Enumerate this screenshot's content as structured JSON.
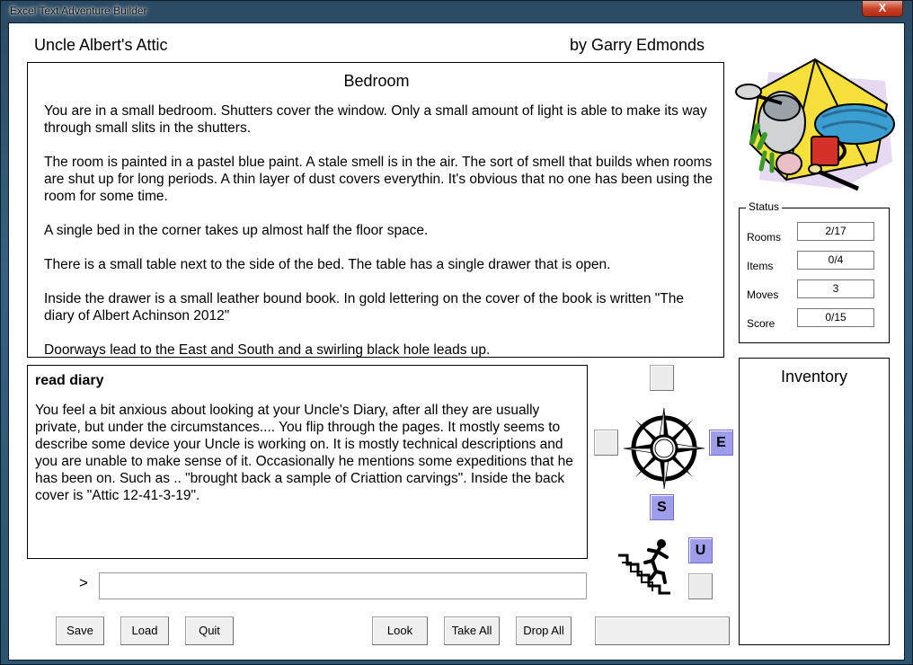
{
  "window": {
    "title": "Excel Text Adventure Builder",
    "close_label": "X"
  },
  "game": {
    "title": "Uncle Albert's Attic",
    "author": "by Garry Edmonds"
  },
  "room": {
    "name": "Bedroom",
    "paragraphs": [
      "You are in a small bedroom. Shutters cover the window. Only a small amount of light is able to make its way through small slits in the shutters.",
      "The room is painted in a pastel blue paint. A stale smell is in the air. The sort of smell that builds when rooms are shut up for long periods. A thin layer of dust covers everythin. It's obvious that no one has been using the room for some time.",
      "A single bed in the corner takes up almost half the floor space.",
      "There is a small table next to the side of the bed. The table has a single drawer that is open.",
      "Inside the drawer is a small leather bound book. In gold lettering on the cover of the book is written \"The diary of Albert Achinson 2012\"",
      "Doorways lead to the East and South and a swirling black hole leads up."
    ]
  },
  "response": {
    "command": "read diary",
    "text": "You feel a bit anxious about looking at your Uncle's Diary, after all they are usually private, but under the circumstances.... You flip through the pages. It mostly seems to describe some device your Uncle is working on. It is mostly technical descriptions and you are unable to make sense of it. Occasionally he mentions some expeditions that he has been on. Such as .. \"brought back a sample of Criattion carvings\". Inside the back cover is \"Attic 12-41-3-19\"."
  },
  "prompt": {
    "symbol": ">",
    "value": "",
    "placeholder": ""
  },
  "buttons": {
    "save": "Save",
    "load": "Load",
    "quit": "Quit",
    "look": "Look",
    "take_all": "Take All",
    "drop_all": "Drop All",
    "blank": ""
  },
  "directions": {
    "north": "",
    "west": "",
    "east": "E",
    "south": "S",
    "up": "U",
    "down": ""
  },
  "status": {
    "legend": "Status",
    "rows": [
      {
        "label": "Rooms",
        "value": "2/17"
      },
      {
        "label": "Items",
        "value": "0/4"
      },
      {
        "label": "Moves",
        "value": "3"
      },
      {
        "label": "Score",
        "value": "0/15"
      }
    ]
  },
  "inventory": {
    "title": "Inventory",
    "items": []
  },
  "colors": {
    "active_direction": "#9d9dea",
    "chrome": "#2b4a63"
  },
  "icons": {
    "compass": "compass-rose-icon",
    "stairs": "climbing-stairs-icon",
    "clipart": "camping-gear-clipart"
  }
}
